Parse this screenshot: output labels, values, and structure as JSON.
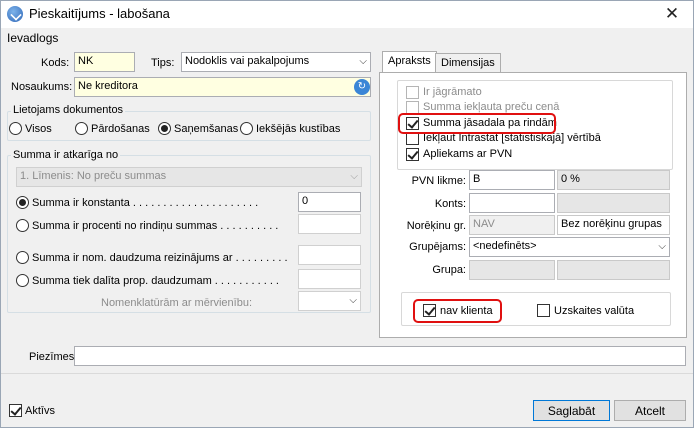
{
  "window": {
    "title": "Pieskaitījums - labošana",
    "close_icon": "✕"
  },
  "menu": {
    "ievadlogs": "Ievadlogs"
  },
  "form": {
    "kods_label": "Kods:",
    "kods_value": "NK",
    "tips_label": "Tips:",
    "tips_value": "Nodoklis vai pakalpojums",
    "nosaukums_label": "Nosaukums:",
    "nosaukums_value": "Ne kreditora"
  },
  "doc_group": {
    "title": "Lietojams dokumentos",
    "options": [
      "Visos",
      "Pārdošanas",
      "Saņemšanas",
      "Iekšējās kustības"
    ],
    "selected": "Saņemšanas"
  },
  "sum_group": {
    "title": "Summa ir atkarīga no",
    "level_select": "1. Līmenis: No preču summas",
    "opt_konstanta": "Summa ir konstanta . . . . . . . . . . . . . . . . . . . . .",
    "konstanta_value": "0",
    "opt_procenti": "Summa ir procenti no rindiņu summas . . . . . . . . . .",
    "opt_reizinajums": "Summa ir nom. daudzuma reizinājums ar . . . . . . . . .",
    "opt_dalita": "Summa tiek dalīta prop. daudzumam . . . . . . . . . . .",
    "nomenklatura_label": "Nomenklatūrām ar mērvienību:"
  },
  "tabs": {
    "apraksts": "Apraksts",
    "dimensijas": "Dimensijas"
  },
  "apraksts": {
    "ir_jagramato": "Ir jāgrāmato",
    "summa_ieklauta": "Summa iekļauta preču cenā",
    "summa_jasadala": "Summa jāsadala pa rindām",
    "ieklaut_intrastat": "Iekļaut Intrastat [statistiskajā] vērtībā",
    "apliekams_pvn": "Apliekams ar PVN",
    "pvn_likme_label": "PVN likme:",
    "pvn_likme_value": "B",
    "pvn_percent": "0 %",
    "konts_label": "Konts:",
    "norekinu_label": "Norēķinu gr.",
    "norekinu_value": "NAV",
    "norekinu_desc": "Bez norēķinu grupas",
    "grupejams_label": "Grupējams:",
    "grupejams_value": "<nedefinēts>",
    "grupa_label": "Grupa:",
    "nav_klienta": "nav klienta",
    "uzskaites_valuta": "Uzskaites valūta"
  },
  "piezimes_label": "Piezīmes:",
  "aktivs_label": "Aktīvs",
  "buttons": {
    "saglabat": "Saglabāt",
    "atcelt": "Atcelt"
  },
  "colors": {
    "highlight": "#e01010",
    "required_field": "#ffffe1",
    "focus_border": "#0078d7"
  }
}
